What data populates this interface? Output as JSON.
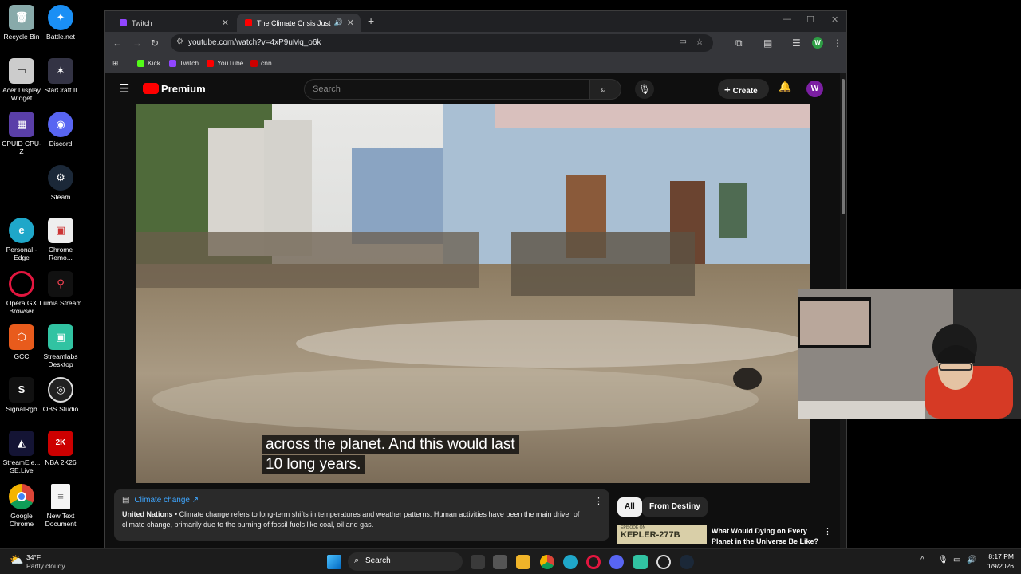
{
  "desktop": {
    "icons": [
      "Recycle Bin",
      "Battle.net",
      "Acer Display Widget",
      "StarCraft II",
      "CPUID CPU-Z",
      "Discord",
      "Steam",
      "Personal - Edge",
      "Chrome Remo...",
      "Opera GX Browser",
      "Lumia Stream",
      "GCC",
      "Streamlabs Desktop",
      "SignalRgb",
      "OBS Studio",
      "StreamEle... SE.Live",
      "NBA 2K26",
      "Google Chrome",
      "New Text Document"
    ]
  },
  "browser": {
    "tabs": [
      {
        "label": "Twitch"
      },
      {
        "label": "The Climate Crisis Just Hit a"
      }
    ],
    "new_tab": "+",
    "url": "youtube.com/watch?v=4xP9uMq_o6k",
    "profile": "W",
    "bookmarks": [
      "Kick",
      "Twitch",
      "YouTube",
      "cnn"
    ]
  },
  "youtube": {
    "logo": "Premium",
    "search_placeholder": "Search",
    "create_label": "Create",
    "avatar": "W",
    "caption_line1": "across the planet. And this would last",
    "caption_line2": "10 long years.",
    "info_title": "Climate change ↗",
    "info_source": "United Nations",
    "info_text": " • Climate change refers to long-term shifts in temperatures and weather patterns. Human activities have been the main driver of climate change, primarily due to the burning of fossil fuels like coal, oil and gas.",
    "chips": [
      "All",
      "From Destiny"
    ],
    "rec_thumb": "KEPLER-277B",
    "rec_thumb_top": "EPISODE ON",
    "rec_title": "What Would Dying on Every Planet in the Universe Be Like?"
  },
  "taskbar": {
    "weather_temp": "34°F",
    "weather_desc": "Partly cloudy",
    "search": "Search",
    "time": "8:17 PM",
    "date": "1/9/2026"
  },
  "colors": {
    "yt_red": "#ff0000",
    "twitch": "#9146ff",
    "kick": "#53fc18",
    "accent": "#3ea6ff",
    "avatar": "#7b1fa2"
  }
}
